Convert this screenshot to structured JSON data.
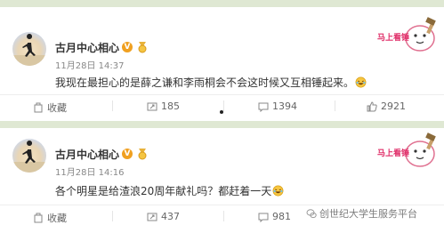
{
  "posts": [
    {
      "user": "古月中心相心",
      "time": "11月28日 14:37",
      "text": "我现在最担心的是薛之谦和李雨桐会不会这时候又互相锤起来。",
      "sticker_text": "马上看锤",
      "actions": {
        "favorite": "收藏",
        "forward": "185",
        "comment": "1394",
        "like": "2921"
      }
    },
    {
      "user": "古月中心相心",
      "time": "11月28日 14:16",
      "text": "各个明星是给渣浪20周年献礼吗？都赶着一天",
      "sticker_text": "马上看锤",
      "actions": {
        "favorite": "收藏",
        "forward": "437",
        "comment": "981"
      }
    }
  ],
  "watermark": "创世纪大学生服务平台",
  "colors": {
    "divider": "#dfe8d3",
    "badge": "#f0a020",
    "text": "#333333",
    "meta": "#888888"
  }
}
